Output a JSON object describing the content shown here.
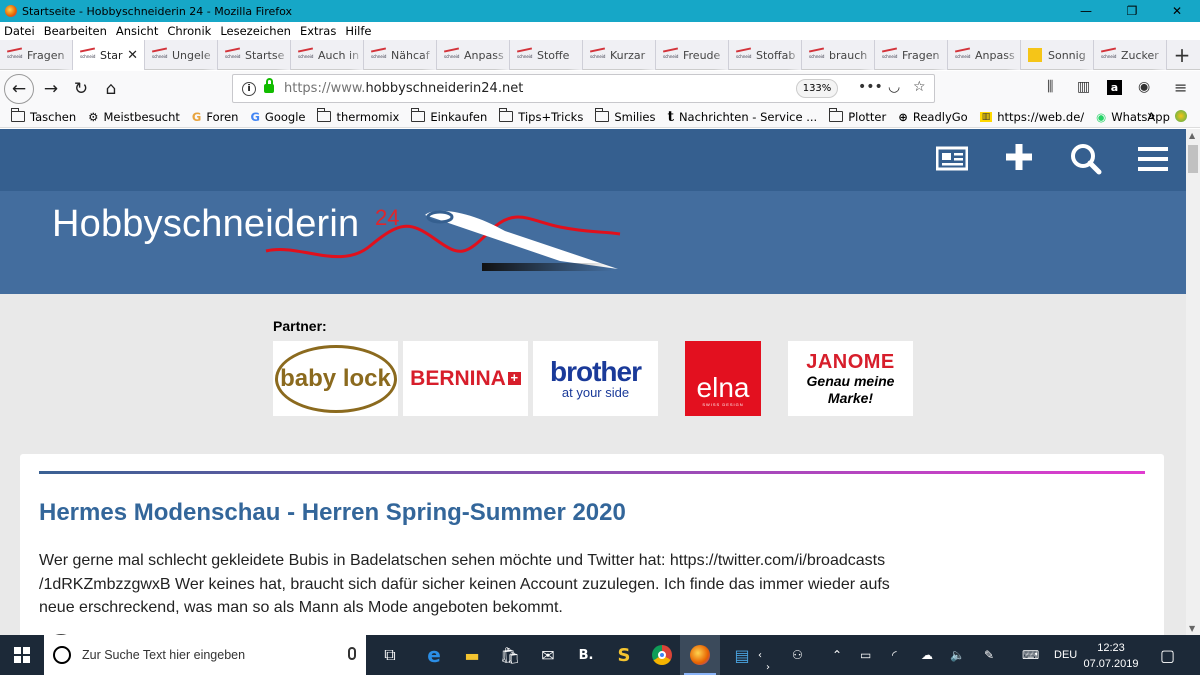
{
  "window": {
    "title": "Startseite - Hobbyschneiderin 24 - Mozilla Firefox",
    "minimize": "—",
    "maximize": "❐",
    "close": "✕"
  },
  "menu": [
    "Datei",
    "Bearbeiten",
    "Ansicht",
    "Chronik",
    "Lesezeichen",
    "Extras",
    "Hilfe"
  ],
  "tabs": [
    {
      "label": "Fragen",
      "active": false
    },
    {
      "label": "Startseite - Hobbyschneiderin 24",
      "short": "Star",
      "active": true
    },
    {
      "label": "Ungele",
      "active": false
    },
    {
      "label": "Startse",
      "active": false
    },
    {
      "label": "Auch in",
      "active": false
    },
    {
      "label": "Nähcaf",
      "active": false
    },
    {
      "label": "Anpass",
      "active": false
    },
    {
      "label": "Stoffe",
      "active": false
    },
    {
      "label": "Kurzar",
      "active": false
    },
    {
      "label": "Freude",
      "active": false
    },
    {
      "label": "Stoffab",
      "active": false
    },
    {
      "label": "brauch",
      "active": false
    },
    {
      "label": "Fragen",
      "active": false
    },
    {
      "label": "Anpass",
      "active": false
    },
    {
      "label": "Sonnig",
      "active": false,
      "sun": true
    },
    {
      "label": "Zucker",
      "active": false
    }
  ],
  "new_tab": "+",
  "nav": {
    "url_host": "https://www.",
    "url_domain": "hobbyschneiderin24.net",
    "zoom": "133%",
    "more": "•••"
  },
  "bookmarks": [
    {
      "label": "Taschen",
      "icon": "folder"
    },
    {
      "label": "Meistbesucht",
      "icon": "gear"
    },
    {
      "label": "Foren",
      "icon": "g-color"
    },
    {
      "label": "Google",
      "icon": "google"
    },
    {
      "label": "thermomix",
      "icon": "folder"
    },
    {
      "label": "Einkaufen",
      "icon": "folder"
    },
    {
      "label": "Tips+Tricks",
      "icon": "folder"
    },
    {
      "label": "Smilies",
      "icon": "folder"
    },
    {
      "label": "Nachrichten - Service ...",
      "icon": "t"
    },
    {
      "label": "Plotter",
      "icon": "folder"
    },
    {
      "label": "ReadlyGo",
      "icon": "globe"
    },
    {
      "label": "https://web.de/",
      "icon": "webde"
    },
    {
      "label": "WhatsApp",
      "icon": "whatsapp"
    }
  ],
  "site": {
    "logo_text": "Hobbyschneiderin",
    "logo_sup": "24",
    "partners_label": "Partner:",
    "partners": [
      {
        "name": "baby lock"
      },
      {
        "name": "BERNINA",
        "mark": "+"
      },
      {
        "name": "brother",
        "tag": "at your side"
      },
      {
        "name": "elna",
        "tag": "SWISS DESIGN"
      },
      {
        "name": "JANOME",
        "tag": "Genau meine Marke!"
      }
    ],
    "post": {
      "title": "Hermes Modenschau - Herren Spring-Summer 2020",
      "body": "Wer gerne mal schlecht gekleidete Bubis in Badelatschen sehen möchte und Twitter hat: https://twitter.com/i/broadcasts /1dRKZmbzzgwxB   Wer keines hat, braucht sich dafür sicher keinen Account zuzulegen. Ich finde das immer wieder aufs neue erschreckend, was man so als Mann als Mode angeboten bekommt."
    }
  },
  "taskbar": {
    "search_placeholder": "Zur Suche Text hier eingeben",
    "lang": "DEU",
    "time": "12:23",
    "date": "07.07.2019"
  },
  "colors": {
    "titlebar": "#16a7c7",
    "site_header": "#355f8f",
    "site_banner": "#436d9e",
    "post_title": "#33669a",
    "taskbar": "#1c2938"
  }
}
